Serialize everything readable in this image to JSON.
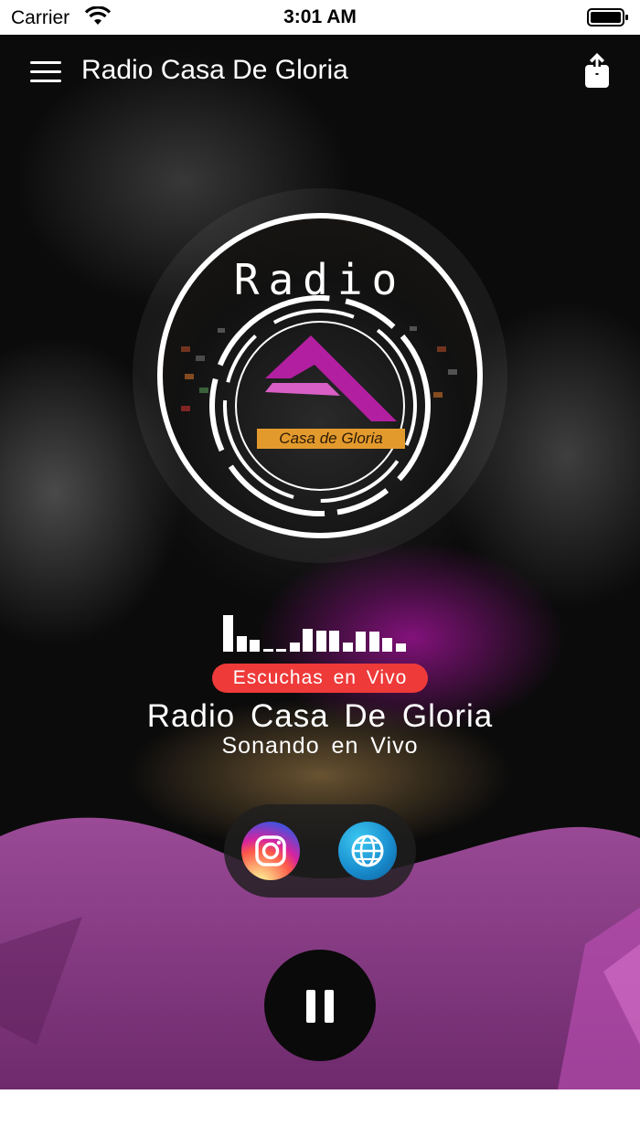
{
  "status_bar": {
    "carrier": "Carrier",
    "time": "3:01 AM",
    "wifi_icon": "wifi-icon",
    "battery_icon": "battery-icon"
  },
  "nav": {
    "title": "Radio Casa De Gloria",
    "menu_icon": "hamburger-menu-icon",
    "share_icon": "share-icon"
  },
  "logo": {
    "word": "Radio",
    "band_text": "Casa de Gloria",
    "colors": {
      "accent": "#b21fa0",
      "band": "#e39a2d"
    }
  },
  "player": {
    "equalizer_levels": [
      1.0,
      0.42,
      0.32,
      0.08,
      0.08,
      0.25,
      0.62,
      0.58,
      0.58,
      0.25,
      0.55,
      0.55,
      0.38,
      0.22
    ],
    "live_badge": "Escuchas en Vivo",
    "station_name": "Radio Casa De Gloria",
    "subtitle": "Sonando en Vivo",
    "state": "playing",
    "pause_icon": "pause-icon"
  },
  "social": {
    "instagram_icon": "instagram-icon",
    "website_icon": "globe-icon"
  },
  "colors": {
    "live_badge": "#ee3a39",
    "wave": "#8e3a8a",
    "background": "#0b0b0b"
  }
}
